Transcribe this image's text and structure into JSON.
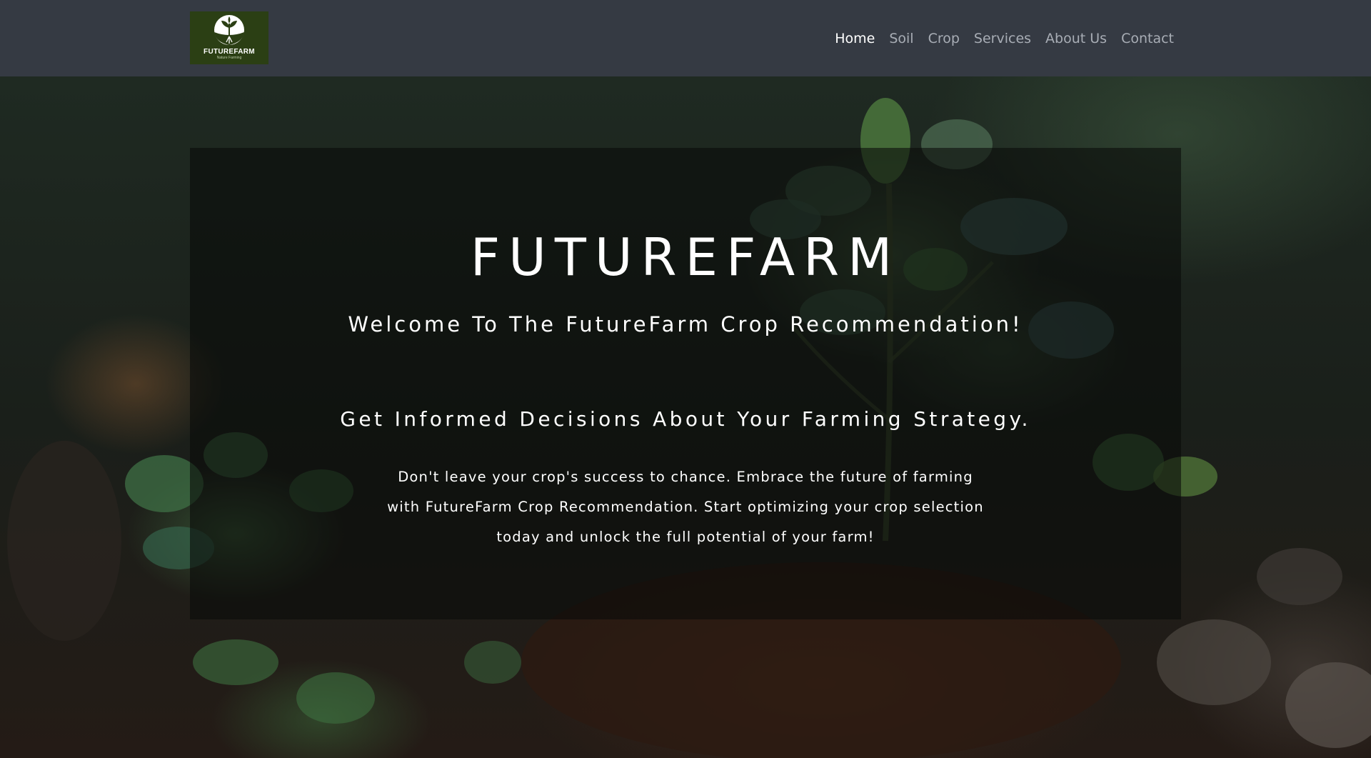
{
  "brand": {
    "logo_title": "FUTUREFARM",
    "logo_tagline": "Nature Farming"
  },
  "nav": {
    "items": [
      {
        "label": "Home",
        "active": true
      },
      {
        "label": "Soil",
        "active": false
      },
      {
        "label": "Crop",
        "active": false
      },
      {
        "label": "Services",
        "active": false
      },
      {
        "label": "About Us",
        "active": false
      },
      {
        "label": "Contact",
        "active": false
      }
    ]
  },
  "hero": {
    "title": "FUTUREFARM",
    "welcome": "Welcome To The FutureFarm Crop Recommendation!",
    "tagline": "Get Informed Decisions About Your Farming Strategy.",
    "body": "Don't leave your crop's success to chance. Embrace the future of farming with FutureFarm Crop Recommendation. Start optimizing your crop selection today and unlock the full potential of your farm!"
  },
  "colors": {
    "navbar_bg": "#353a43",
    "nav_active": "#ffffff",
    "nav_inactive": "#a8adb5",
    "logo_bg": "#2b3f14"
  }
}
